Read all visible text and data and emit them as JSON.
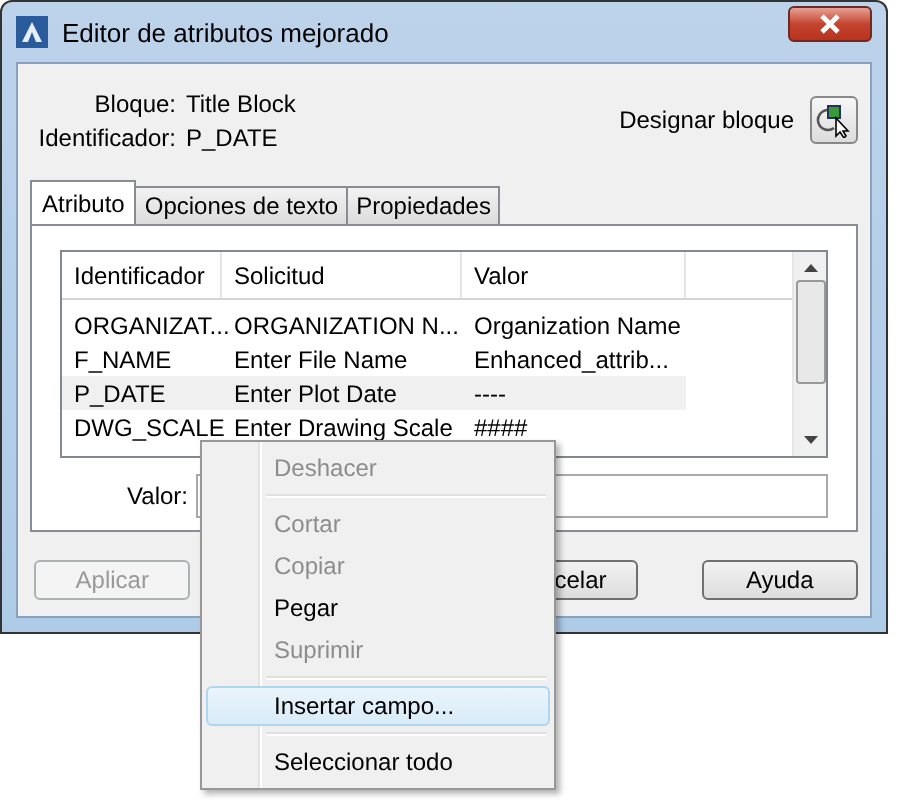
{
  "window": {
    "title": "Editor de atributos mejorado"
  },
  "block": {
    "label": "Bloque:",
    "value": "Title Block"
  },
  "tag": {
    "label": "Identificador:",
    "value": "P_DATE"
  },
  "select_block": {
    "label": "Designar bloque"
  },
  "tabs": [
    {
      "label": "Atributo",
      "selected": true
    },
    {
      "label": "Opciones de texto",
      "selected": false
    },
    {
      "label": "Propiedades",
      "selected": false
    }
  ],
  "table": {
    "columns": [
      "Identificador",
      "Solicitud",
      "Valor"
    ],
    "rows": [
      {
        "cells": [
          "ORGANIZAT...",
          "ORGANIZATION N...",
          "Organization Name"
        ],
        "selected": false
      },
      {
        "cells": [
          "F_NAME",
          "Enter File Name",
          "Enhanced_attrib..."
        ],
        "selected": false
      },
      {
        "cells": [
          "P_DATE",
          "Enter Plot Date",
          "----"
        ],
        "selected": true
      },
      {
        "cells": [
          "DWG_SCALE",
          "Enter Drawing Scale",
          "####"
        ],
        "selected": false
      }
    ]
  },
  "value_field": {
    "label": "Valor:"
  },
  "buttons": [
    {
      "label": "Aplicar",
      "disabled": true
    },
    {
      "label": "celar",
      "disabled": false
    },
    {
      "label": "Ayuda",
      "disabled": false
    }
  ],
  "context_menu": [
    {
      "kind": "item",
      "label": "Deshacer",
      "disabled": true,
      "selected": false
    },
    {
      "kind": "separator"
    },
    {
      "kind": "item",
      "label": "Cortar",
      "disabled": true,
      "selected": false
    },
    {
      "kind": "item",
      "label": "Copiar",
      "disabled": true,
      "selected": false
    },
    {
      "kind": "item",
      "label": "Pegar",
      "disabled": false,
      "selected": false
    },
    {
      "kind": "item",
      "label": "Suprimir",
      "disabled": true,
      "selected": false
    },
    {
      "kind": "separator"
    },
    {
      "kind": "item",
      "label": "Insertar campo...",
      "disabled": false,
      "selected": true
    },
    {
      "kind": "separator"
    },
    {
      "kind": "item",
      "label": "Seleccionar todo",
      "disabled": false,
      "selected": false
    }
  ]
}
